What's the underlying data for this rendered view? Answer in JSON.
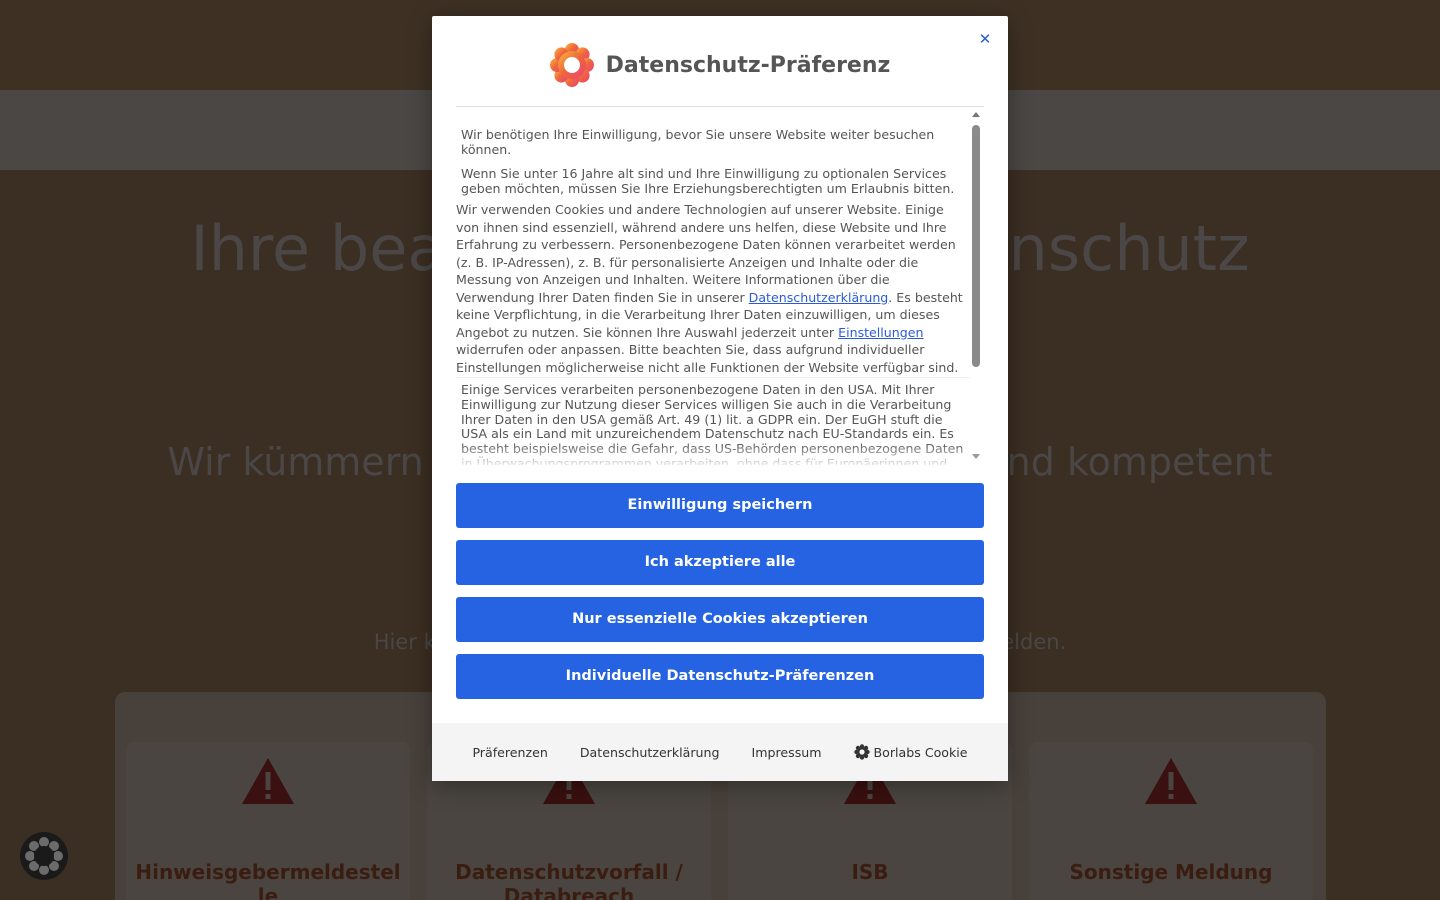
{
  "background": {
    "hero_title": "Ihre beauftragten für Datenschutz",
    "hero_subtitle": "Wir kümmern uns um Ihr Anliegen zeitnah und kompetent",
    "hero_hint": "Hier können Sie uns einen datenschutzrechtlichen Vorfall melden.",
    "cards": [
      {
        "title": "Hinweisgebermeldestelle",
        "icon": "warning-icon"
      },
      {
        "title": "Datenschutzvorfall / Databreach",
        "icon": "warning-icon"
      },
      {
        "title": "ISB",
        "icon": "warning-icon"
      },
      {
        "title": "Sonstige Meldung",
        "icon": "warning-icon"
      }
    ]
  },
  "modal": {
    "title": "Datenschutz-Präferenz",
    "close_icon": "close-icon",
    "paragraph_1": "Wir benötigen Ihre Einwilligung, bevor Sie unsere Website weiter besuchen können.",
    "paragraph_2": "Wenn Sie unter 16 Jahre alt sind und Ihre Einwilligung zu optionalen Services geben möchten, müssen Sie Ihre Erziehungsberechtigten um Erlaubnis bitten.",
    "paragraph_3_a": "Wir verwenden Cookies und andere Technologien auf unserer Website. Einige von ihnen sind essenziell, während andere uns helfen, diese Website und Ihre Erfahrung zu verbessern.    Personenbezogene Daten können verarbeitet werden (z. B. IP-Adressen), z. B. für personalisierte Anzeigen und Inhalte oder die Messung von Anzeigen und Inhalten.    Weitere Informationen über die Verwendung Ihrer Daten finden Sie in unserer ",
    "link_privacy": "Datenschutzerklärung",
    "paragraph_3_b": ".    Es besteht keine Verpflichtung, in die Verarbeitung Ihrer Daten einzuwilligen, um dieses Angebot zu nutzen.    Sie können Ihre Auswahl jederzeit unter ",
    "link_settings": "Einstellungen",
    "paragraph_3_c": " widerrufen oder anpassen.    Bitte beachten Sie, dass aufgrund individueller Einstellungen möglicherweise nicht alle Funktionen der Website verfügbar sind.",
    "us_notice": "Einige Services verarbeiten personenbezogene Daten in den USA. Mit Ihrer Einwilligung zur Nutzung dieser Services willigen Sie auch in die Verarbeitung Ihrer Daten in den USA gemäß Art. 49 (1) lit. a GDPR ein. Der EuGH stuft die USA als ein Land mit unzureichendem Datenschutz nach EU-Standards ein. Es besteht beispielsweise die Gefahr, dass US-Behörden personenbezogene Daten in Überwachungsprogrammen verarbeiten, ohne dass für Europäerinnen und",
    "buttons": {
      "save": "Einwilligung speichern",
      "accept_all": "Ich akzeptiere alle",
      "essential_only": "Nur essenzielle Cookies akzeptieren",
      "individual": "Individuelle Datenschutz-Präferenzen"
    },
    "footer": {
      "preferences": "Präferenzen",
      "privacy": "Datenschutzerklärung",
      "imprint": "Impressum",
      "borlabs": "Borlabs Cookie"
    }
  },
  "colors": {
    "accent": "#2563e3",
    "link": "#2a5bd7",
    "card_title": "#3a1d10",
    "warning": "#3a1010"
  }
}
